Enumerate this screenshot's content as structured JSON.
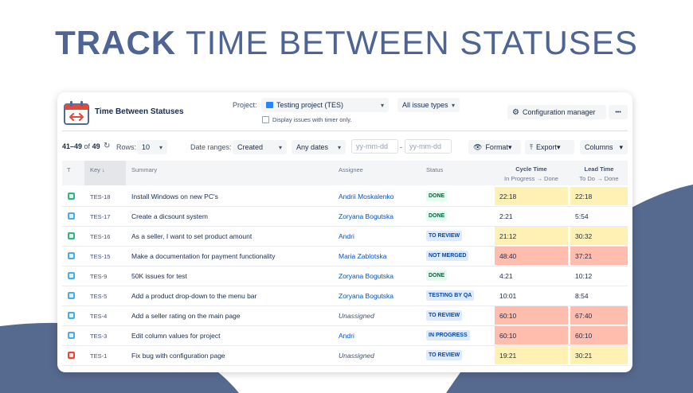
{
  "hero": {
    "bold": "TRACK",
    "rest": "TIME BETWEEN STATUSES"
  },
  "colors": {
    "hero_text": "#4d6494",
    "wave": "#56698f",
    "yellow": "#fff1b3",
    "red": "#ffbdad",
    "link": "#0052cc"
  },
  "app": {
    "title": "Time Between Statuses",
    "icon": "calendar-arrows-icon"
  },
  "filters": {
    "project_label": "Project:",
    "project_value": "Testing project (TES)",
    "issue_types": "All issue types",
    "timer_only": "Display issues with timer only.",
    "config_button": "Configuration manager",
    "more_button": "•••",
    "rows_label": "Rows:",
    "rows_value": "10",
    "date_ranges_label": "Date ranges:",
    "date_field": "Created",
    "date_preset": "Any dates",
    "date_from_placeholder": "yy-mm-dd",
    "date_sep": "-",
    "date_to_placeholder": "yy-mm-dd",
    "format_button": "Format",
    "export_button": "Export",
    "columns_button": "Columns"
  },
  "pager": {
    "range": "41–49",
    "of": "of",
    "total": "49"
  },
  "columns": {
    "type": "T",
    "key": "Key",
    "summary": "Summary",
    "assignee": "Assignee",
    "status": "Status",
    "cycle_title": "Cycle Time",
    "cycle_sub": "In Progress → Done",
    "lead_title": "Lead Time",
    "lead_sub": "To Do → Done"
  },
  "rows": [
    {
      "type": "story",
      "key": "TES-18",
      "summary": "Install Windows on new PC's",
      "assignee": "Andrii Moskalenko",
      "unassigned": false,
      "status": "DONE",
      "status_style": "done",
      "cycle": "22:18",
      "cycle_color": "yellow",
      "lead": "22:18",
      "lead_color": "yellow"
    },
    {
      "type": "task",
      "key": "TES-17",
      "summary": "Create a dicsount system",
      "assignee": "Zoryana Bogutska",
      "unassigned": false,
      "status": "DONE",
      "status_style": "done",
      "cycle": "2:21",
      "cycle_color": "none",
      "lead": "5:54",
      "lead_color": "none"
    },
    {
      "type": "story",
      "key": "TES-16",
      "summary": "As a seller, I want to set product amount",
      "assignee": "Andri",
      "unassigned": false,
      "status": "TO REVIEW",
      "status_style": "blue",
      "cycle": "21:12",
      "cycle_color": "yellow",
      "lead": "30:32",
      "lead_color": "yellow"
    },
    {
      "type": "task",
      "key": "TES-15",
      "summary": "Make a documentation for payment functionality",
      "assignee": "Maria Zablotska",
      "unassigned": false,
      "status": "NOT MERGED",
      "status_style": "blue",
      "cycle": "48:40",
      "cycle_color": "red",
      "lead": "37:21",
      "lead_color": "red"
    },
    {
      "type": "task",
      "key": "TES-9",
      "summary": "50K issues for test",
      "assignee": "Zoryana Bogutska",
      "unassigned": false,
      "status": "DONE",
      "status_style": "done",
      "cycle": "4:21",
      "cycle_color": "none",
      "lead": "10:12",
      "lead_color": "none"
    },
    {
      "type": "task",
      "key": "TES-5",
      "summary": "Add a product drop-down to the menu bar",
      "assignee": "Zoryana Bogutska",
      "unassigned": false,
      "status": "TESTING BY QA",
      "status_style": "blue",
      "cycle": "10:01",
      "cycle_color": "none",
      "lead": "8:54",
      "lead_color": "none"
    },
    {
      "type": "task",
      "key": "TES-4",
      "summary": "Add a seller rating on the main page",
      "assignee": "Unassigned",
      "unassigned": true,
      "status": "TO REVIEW",
      "status_style": "blue",
      "cycle": "60:10",
      "cycle_color": "red",
      "lead": "67:40",
      "lead_color": "red"
    },
    {
      "type": "task",
      "key": "TES-3",
      "summary": "Edit column values for project",
      "assignee": "Andri",
      "unassigned": false,
      "status": "IN PROGRESS",
      "status_style": "blue",
      "cycle": "60:10",
      "cycle_color": "red",
      "lead": "60:10",
      "lead_color": "red"
    },
    {
      "type": "bug",
      "key": "TES-1",
      "summary": "Fix bug with configuration page",
      "assignee": "Unassigned",
      "unassigned": true,
      "status": "TO REVIEW",
      "status_style": "blue",
      "cycle": "19:21",
      "cycle_color": "yellow",
      "lead": "30:21",
      "lead_color": "yellow"
    }
  ]
}
